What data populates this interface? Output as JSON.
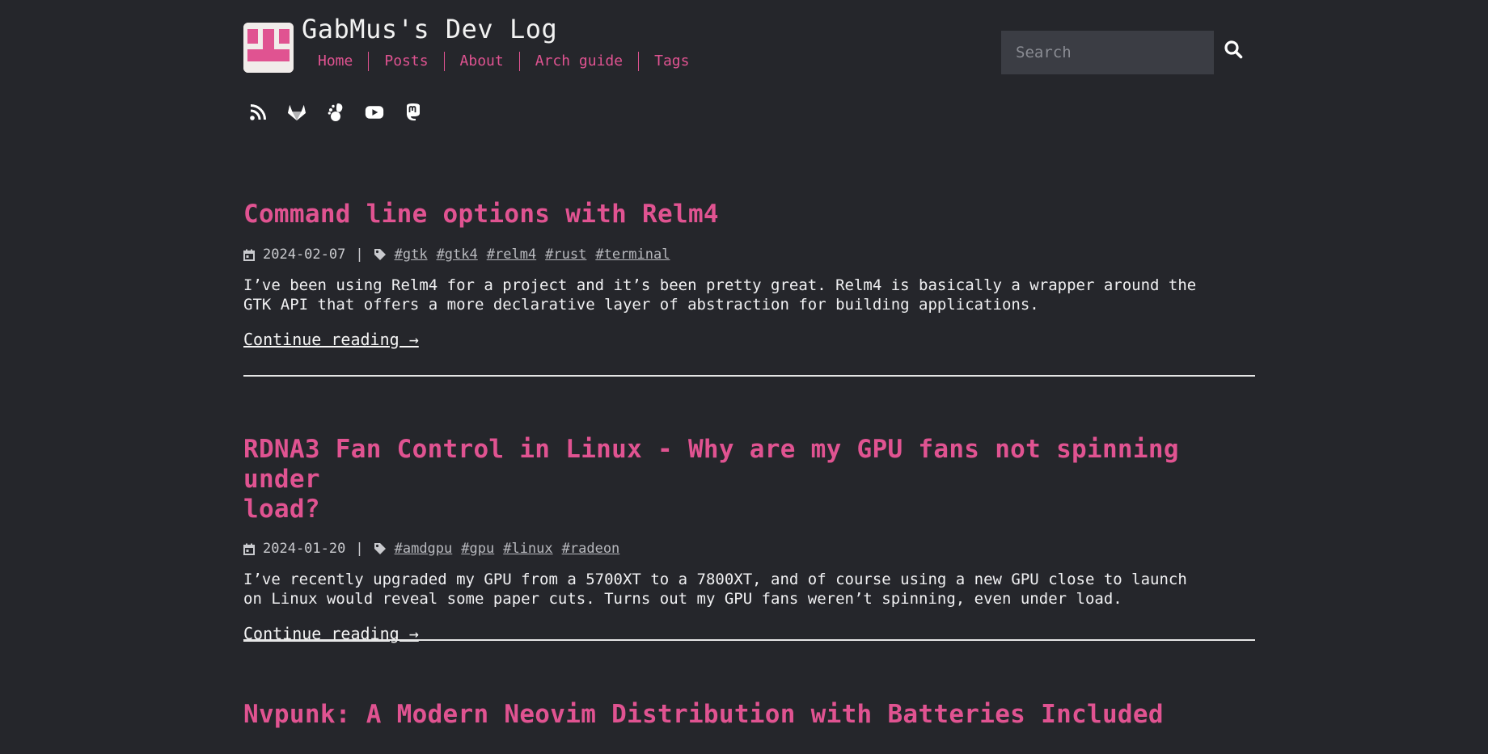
{
  "site": {
    "title": "GabMus's Dev Log",
    "nav": [
      "Home",
      "Posts",
      "About",
      "Arch guide",
      "Tags"
    ],
    "search_placeholder": "Search"
  },
  "social_icons": [
    "rss-icon",
    "gitlab-icon",
    "gnome-icon",
    "youtube-icon",
    "mastodon-icon"
  ],
  "colors": {
    "accent": "#e05391",
    "background": "#25262b",
    "search_bg": "#3b3d44"
  },
  "posts": [
    {
      "title": "Command line options with Relm4",
      "date": "2024-02-07",
      "tags": [
        "#gtk",
        "#gtk4",
        "#relm4",
        "#rust",
        "#terminal"
      ],
      "summary_line1": "I’ve been using Relm4 for a project and it’s been pretty great. Relm4 is basically a wrapper around the",
      "summary_line2": "GTK API that offers a more declarative layer of abstraction for building applications.",
      "more": "Continue reading →"
    },
    {
      "title_line1": "RDNA3 Fan Control in Linux - Why are my GPU fans not spinning under",
      "title_line2": "load?",
      "date": "2024-01-20",
      "tags": [
        "#amdgpu",
        "#gpu",
        "#linux",
        "#radeon"
      ],
      "summary_line1": "I’ve recently upgraded my GPU from a 5700XT to a 7800XT, and of course using a new GPU close to launch",
      "summary_line2": "on Linux would reveal some paper cuts. Turns out my GPU fans weren’t spinning, even under load.",
      "more": "Continue reading →"
    },
    {
      "title": "Nvpunk: A Modern Neovim Distribution with Batteries Included"
    }
  ]
}
